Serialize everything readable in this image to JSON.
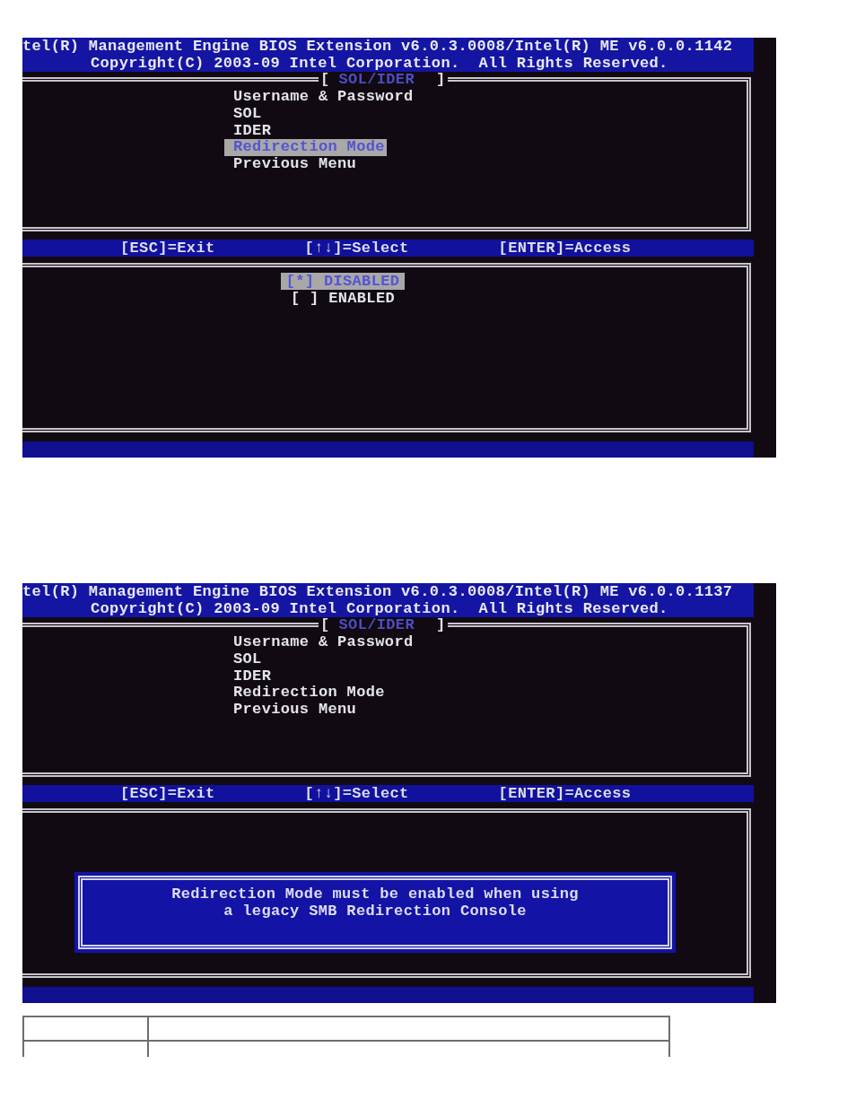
{
  "screens": [
    {
      "header": {
        "title": "tel(R) Management Engine BIOS Extension v6.0.3.0008/Intel(R) ME v6.0.0.1142",
        "copyright": "Copyright(C) 2003-09 Intel Corporation.  All Rights Reserved."
      },
      "menu": {
        "title": {
          "left": "[",
          "label": "SOL/IDER",
          "right": "]"
        },
        "items": [
          {
            "label": "Username & Password",
            "selected": false
          },
          {
            "label": "SOL",
            "selected": false
          },
          {
            "label": "IDER",
            "selected": false
          },
          {
            "label": "Redirection Mode",
            "selected": true
          },
          {
            "label": "Previous Menu",
            "selected": false
          }
        ]
      },
      "status_bar": [
        "[ESC]=Exit",
        "[↑↓]=Select",
        "[ENTER]=Access"
      ],
      "panel": {
        "kind": "options",
        "options": [
          {
            "label": "[*] DISABLED",
            "selected": true
          },
          {
            "label": "[ ] ENABLED",
            "selected": false
          }
        ]
      }
    },
    {
      "header": {
        "title": "tel(R) Management Engine BIOS Extension v6.0.3.0008/Intel(R) ME v6.0.0.1137",
        "copyright": "Copyright(C) 2003-09 Intel Corporation.  All Rights Reserved."
      },
      "menu": {
        "title": {
          "left": "[",
          "label": "SOL/IDER",
          "right": "]"
        },
        "items": [
          {
            "label": "Username & Password",
            "selected": false
          },
          {
            "label": "SOL",
            "selected": false
          },
          {
            "label": "IDER",
            "selected": false
          },
          {
            "label": "Redirection Mode",
            "selected": false
          },
          {
            "label": "Previous Menu",
            "selected": false
          }
        ]
      },
      "status_bar": [
        "[ESC]=Exit",
        "[↑↓]=Select",
        "[ENTER]=Access"
      ],
      "panel": {
        "kind": "message",
        "message": [
          "Redirection Mode must be enabled when using",
          "a legacy SMB Redirection Console"
        ]
      }
    }
  ],
  "table": {
    "rows": [
      {
        "cells": [
          {
            "kind": "blank"
          },
          {
            "kind": "blank"
          }
        ],
        "clipped": false
      },
      {
        "cells": [
          {
            "kind": "blank"
          },
          {
            "kind": "blank"
          }
        ],
        "clipped": true
      }
    ]
  }
}
